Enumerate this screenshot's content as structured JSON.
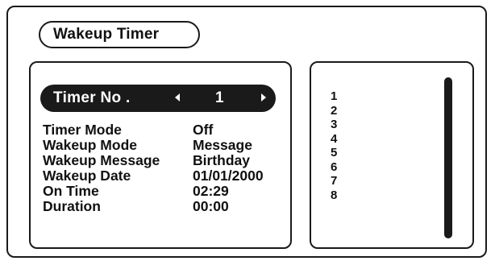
{
  "title": "Wakeup Timer",
  "timer_selector": {
    "label": "Timer No .",
    "value": "1",
    "prev_icon": "triangle-left-icon",
    "next_icon": "triangle-right-icon"
  },
  "fields": [
    {
      "label": "Timer Mode",
      "value": "Off"
    },
    {
      "label": "Wakeup Mode",
      "value": "Message"
    },
    {
      "label": "Wakeup Message",
      "value": "Birthday"
    },
    {
      "label": "Wakeup Date",
      "value": "01/01/2000"
    },
    {
      "label": "On Time",
      "value": "02:29"
    },
    {
      "label": "Duration",
      "value": "00:00"
    }
  ],
  "timer_list": [
    "1",
    "2",
    "3",
    "4",
    "5",
    "6",
    "7",
    "8"
  ],
  "colors": {
    "foreground": "#1a1a1a",
    "background": "#ffffff"
  }
}
